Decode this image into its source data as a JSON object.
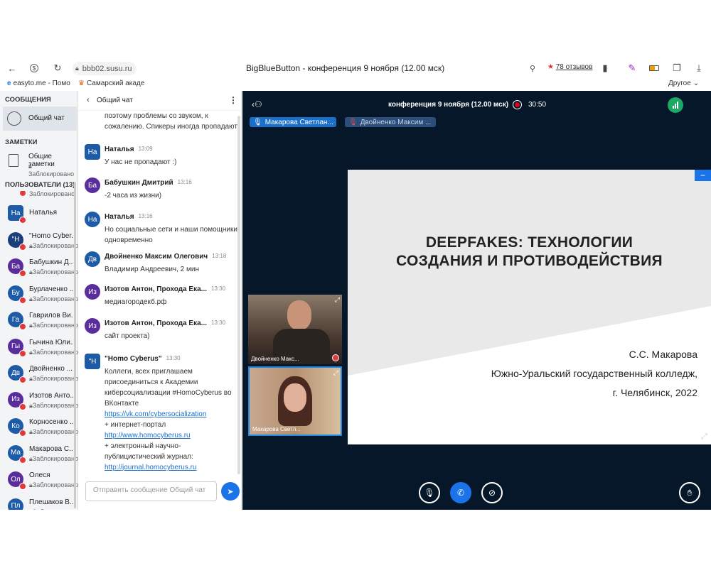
{
  "browser": {
    "url": "bbb02.susu.ru",
    "window_title": "BigBlueButton - конференция 9 ноября (12.00 мск)",
    "reviews": "78 отзывов",
    "bookmarks": [
      "easyto.me - Помо",
      "Самарский акаде"
    ],
    "other_bookmarks": "Другое"
  },
  "sidebar": {
    "messages_header": "СООБЩЕНИЯ",
    "public_chat": "Общий чат",
    "notes_header": "ЗАМЕТКИ",
    "shared_notes": "Общие заметки",
    "shared_notes_status": "Заблокировано",
    "users_header": "ПОЛЬЗОВАТЕЛИ (13)",
    "top_partial_status": "Заблокировано",
    "users": [
      {
        "initials": "На",
        "name": "Наталья",
        "status": ""
      },
      {
        "initials": "\"Н",
        "name": "\"Homo Cyber...",
        "status": "Заблокировано"
      },
      {
        "initials": "Ба",
        "name": "Бабушкин Д...",
        "status": "Заблокировано"
      },
      {
        "initials": "Бу",
        "name": "Бурлаченко ...",
        "status": "Заблокировано"
      },
      {
        "initials": "Га",
        "name": "Гаврилов Ви...",
        "status": "Заблокировано"
      },
      {
        "initials": "Гы",
        "name": "Гычина Юли...",
        "status": "Заблокировано"
      },
      {
        "initials": "Дв",
        "name": "Двойненко ...",
        "status": "Заблокировано"
      },
      {
        "initials": "Из",
        "name": "Изотов Анто...",
        "status": "Заблокировано"
      },
      {
        "initials": "Ко",
        "name": "Корносенко ...",
        "status": "Заблокировано"
      },
      {
        "initials": "Ма",
        "name": "Макарова С...",
        "status": "Заблокировано"
      },
      {
        "initials": "Ол",
        "name": "Олеся",
        "status": "Заблокировано"
      },
      {
        "initials": "Пл",
        "name": "Плешаков В...",
        "status": "Заблокировано"
      }
    ]
  },
  "chat": {
    "title": "Общий чат",
    "partial_top": [
      "поэтому проблемы со звуком, к",
      "сожалению. Спикеры иногда пропадают"
    ],
    "messages": [
      {
        "initials": "На",
        "name": "Наталья",
        "time": "13:09",
        "lines": [
          "У нас не пропадают :)"
        ]
      },
      {
        "initials": "Ба",
        "name": "Бабушкин Дмитрий",
        "time": "13:16",
        "lines": [
          "-2 часа из жизни)"
        ]
      },
      {
        "initials": "На",
        "name": "Наталья",
        "time": "13:16",
        "lines": [
          "Но социальные сети и наши помощники",
          "одновременно"
        ]
      },
      {
        "initials": "Дв",
        "name": "Двойненко Максим Олегович",
        "time": "13:18",
        "lines": [
          "Владимир Андреевич, 2 мин"
        ]
      },
      {
        "initials": "Из",
        "name": "Изотов Антон, Прохода Ека...",
        "time": "13:30",
        "lines": [
          "медиагородекб.рф"
        ]
      },
      {
        "initials": "Из",
        "name": "Изотов Антон, Прохода Ека...",
        "time": "13:30",
        "lines": [
          "сайт проекта)"
        ]
      }
    ],
    "homo": {
      "initials": "\"Н",
      "name": "\"Homo Cyberus\"",
      "time": "13:30",
      "line1": "Коллеги, всех приглашаем",
      "line2": "присоединиться к Академии",
      "line3": "киберсоциализации #HomoCyberus во",
      "line4": "ВКонтакте",
      "link1": "https://vk.com/cybersocialization",
      "line5": "+ интернет-портал",
      "link2": "http://www.homocyberus.ru",
      "line6": "+ электронный научно-",
      "line7": "публицистический журнал:",
      "link3": "http://journal.homocyberus.ru"
    },
    "input_placeholder": "Отправить сообщение Общий чат"
  },
  "meeting": {
    "title": "конференция 9 ноября (12.00 мск)",
    "rec_time": "30:50",
    "talkers": [
      "Макарова Светлан...",
      "Двойненко Максим ..."
    ],
    "videos": [
      "Двойненко Макс...",
      "Макарова Светл..."
    ]
  },
  "slide": {
    "title_line1": "DEEPFAKES:  ТЕХНОЛОГИИ",
    "title_line2": "СОЗДАНИЯ И ПРОТИВОДЕЙСТВИЯ",
    "author": "С.С. Макарова",
    "org": "Южно-Уральский государственный колледж,",
    "city": "г. Челябинск, 2022"
  }
}
